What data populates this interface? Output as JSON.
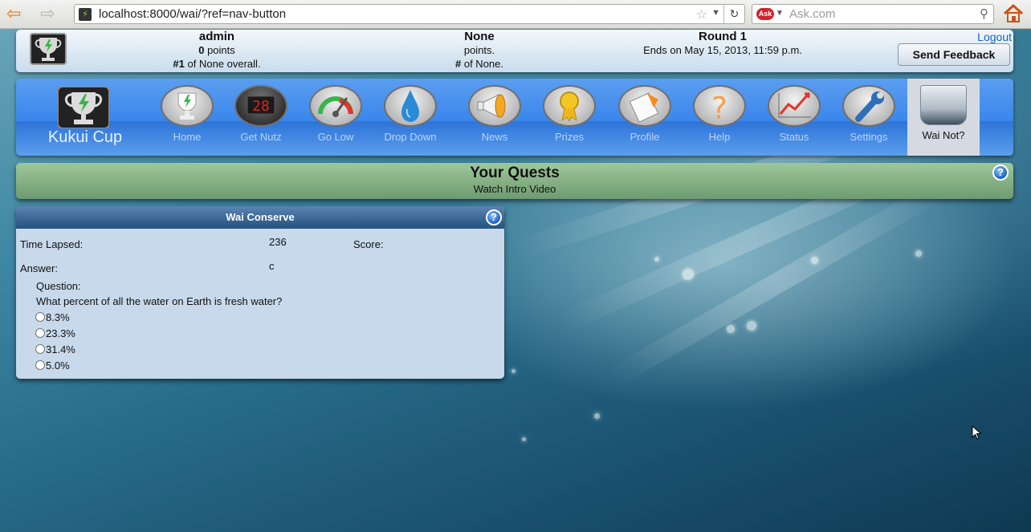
{
  "browser": {
    "url": "localhost:8000/wai/?ref=nav-button",
    "search_placeholder": "Ask.com",
    "search_engine_logo": "Ask",
    "icons": [
      "back-arrow",
      "forward-arrow",
      "site-favicon",
      "bookmark-star",
      "dropdown",
      "reload",
      "search-magnifier",
      "home"
    ]
  },
  "info_bar": {
    "user": {
      "name": "admin",
      "points_value": "0",
      "points_label": " points",
      "rank_value": "#1",
      "rank_label": " of None overall."
    },
    "team": {
      "name": "None",
      "points_label": "points.",
      "rank_value": "#",
      "rank_label": " of None."
    },
    "round": {
      "name": "Round 1",
      "ends": "Ends on May 15, 2013, 11:59 p.m."
    },
    "logout": "Logout",
    "feedback_button": "Send Feedback"
  },
  "nav": {
    "brand": "Kukui Cup",
    "items": [
      {
        "label": "Home",
        "icon": "trophy-icon"
      },
      {
        "label": "Get Nutz",
        "icon": "scoreboard-icon"
      },
      {
        "label": "Go Low",
        "icon": "gauge-icon"
      },
      {
        "label": "Drop Down",
        "icon": "water-drop-icon"
      },
      {
        "label": "News",
        "icon": "megaphone-icon"
      },
      {
        "label": "Prizes",
        "icon": "prize-medal-icon"
      },
      {
        "label": "Profile",
        "icon": "profile-card-icon"
      },
      {
        "label": "Help",
        "icon": "question-mark-icon"
      },
      {
        "label": "Status",
        "icon": "status-chart-icon"
      },
      {
        "label": "Settings",
        "icon": "wrench-icon"
      },
      {
        "label": "Wai Not?",
        "icon": "water-glass-icon",
        "active": true
      }
    ]
  },
  "quests": {
    "title": "Your Quests",
    "subtitle": "Watch Intro Video"
  },
  "wai_conserve": {
    "title": "Wai Conserve",
    "time_lapsed_label": "Time Lapsed:",
    "time_lapsed_value": "236",
    "score_label": "Score:",
    "answer_label": "Answer:",
    "answer_value": "c",
    "question_label": "Question:",
    "question_text": "What percent of all the water on Earth is fresh water?",
    "options": [
      "8.3%",
      "23.3%",
      "31.4%",
      "5.0%"
    ]
  },
  "colors": {
    "accent_blue": "#3a86ec",
    "quests_green": "#7fa97f",
    "panel_bg": "#c7d9eb",
    "link": "#1764c4"
  }
}
